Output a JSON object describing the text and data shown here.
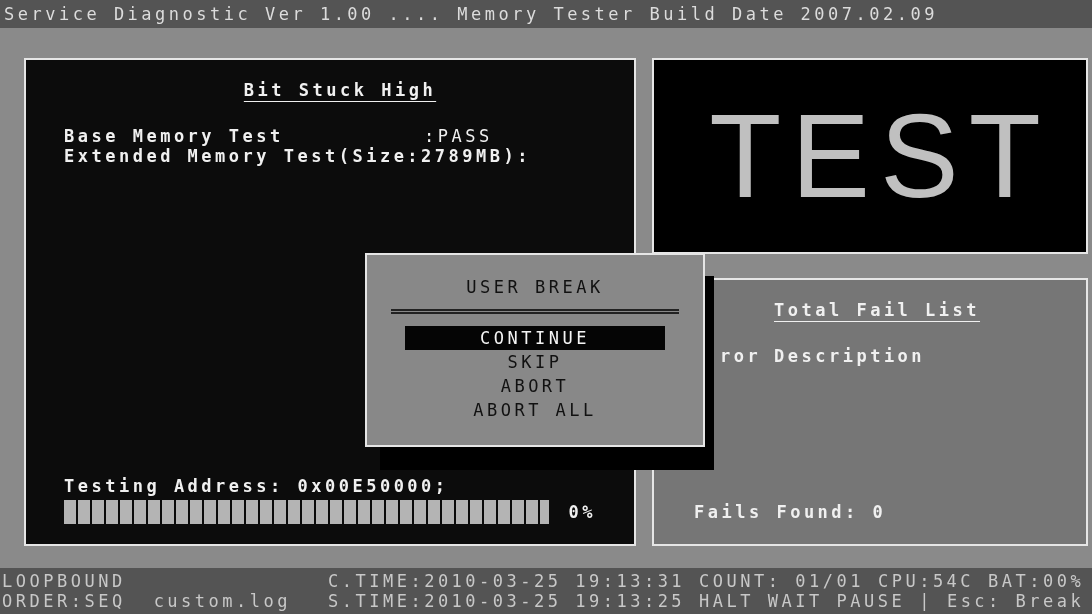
{
  "title_bar": {
    "title": "Service Diagnostic Ver 1.00 .... Memory Tester Build Date 2007.02.09"
  },
  "test_panel": {
    "heading": "Bit Stuck High",
    "lines": [
      {
        "label": "Base Memory Test",
        "value": ":PASS"
      },
      {
        "label": "Extended Memory Test(Size:2789MB):"
      }
    ],
    "address": "Testing Address: 0x00E50000;",
    "progress": {
      "level": 0,
      "reading": "0%"
    }
  },
  "banner": {
    "text": "TEST"
  },
  "fail_list": {
    "heading": "Total Fail List",
    "columns": [
      "ror",
      "Description"
    ],
    "summary": "Fails Found: 0"
  },
  "dialog": {
    "title": "USER BREAK",
    "options": [
      {
        "label": "CONTINUE",
        "selected": true
      },
      {
        "label": "SKIP",
        "selected": false
      },
      {
        "label": "ABORT",
        "selected": false
      },
      {
        "label": "ABORT ALL",
        "selected": false
      }
    ]
  },
  "status_bar": {
    "lines": [
      {
        "left": [
          "LOOPBOUND"
        ],
        "right": [
          "C.TIME:2010-03-25 19:13:31",
          "COUNT: 01/01",
          "CPU:54C",
          "BAT:00%"
        ]
      },
      {
        "left": [
          "ORDER:SEQ",
          "custom.log"
        ],
        "right": [
          "S.TIME:2010-03-25 19:13:25",
          "HALT WAIT PAUSE",
          "|",
          "Esc: Break"
        ]
      }
    ]
  }
}
